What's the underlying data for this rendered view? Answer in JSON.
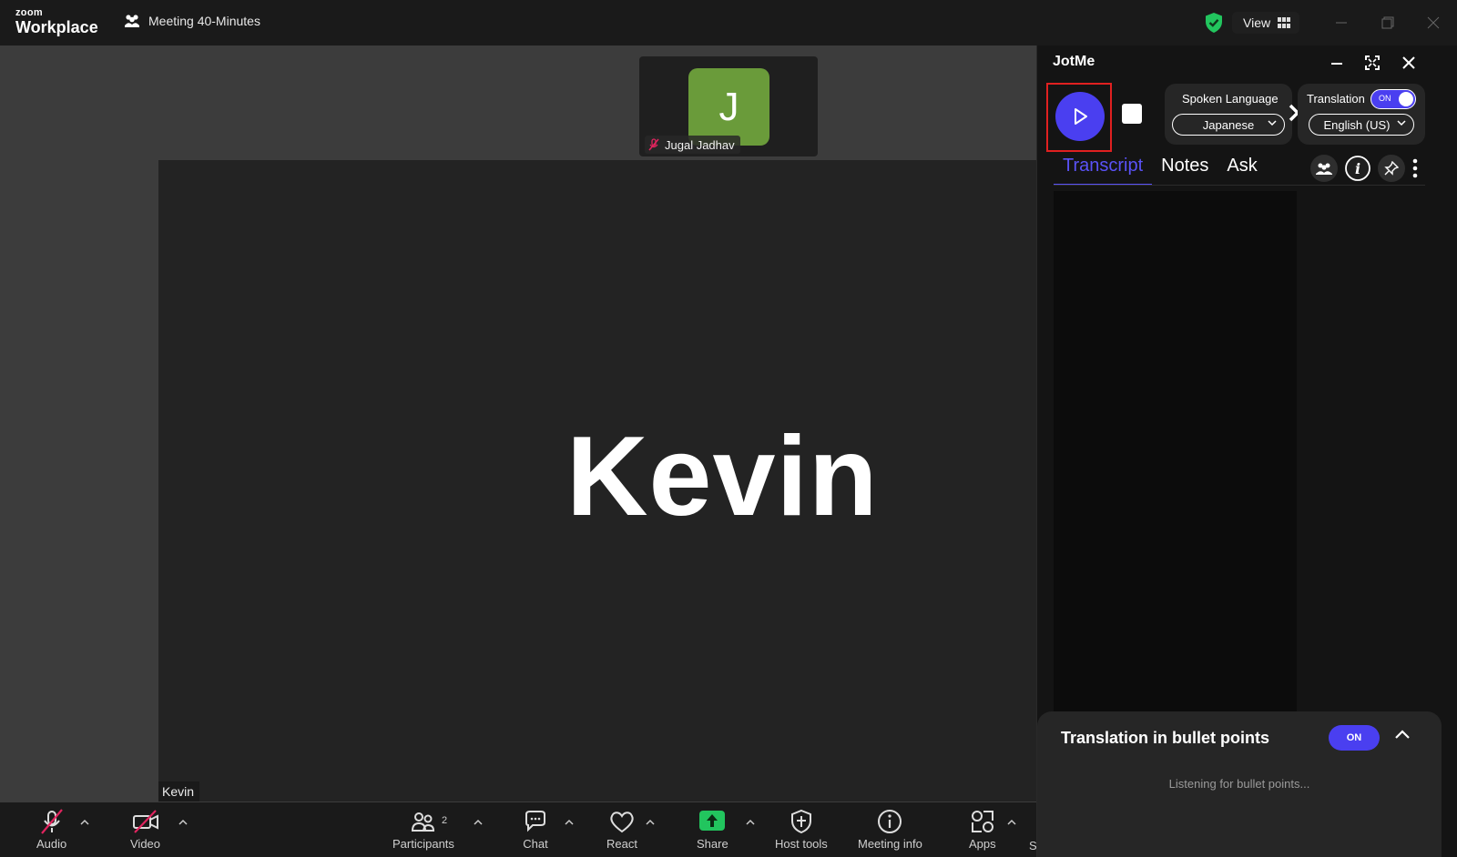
{
  "app": {
    "logo_small": "zoom",
    "logo_big": "Workplace",
    "meeting_title": "Meeting 40-Minutes",
    "view_label": "View"
  },
  "video": {
    "thumbnail_initial": "J",
    "thumbnail_name": "Jugal Jadhav",
    "main_name": "Kevin",
    "main_label": "Kevin"
  },
  "toolbar": {
    "audio": "Audio",
    "video": "Video",
    "participants": "Participants",
    "participants_count": "2",
    "chat": "Chat",
    "react": "React",
    "share": "Share",
    "host_tools": "Host tools",
    "meeting_info": "Meeting info",
    "apps": "Apps",
    "truncated": "S"
  },
  "jotme": {
    "title": "JotMe",
    "spoken_language_label": "Spoken Language",
    "spoken_language_value": "Japanese",
    "translation_label": "Translation",
    "translation_toggle": "ON",
    "target_language_value": "English (US)",
    "tabs": [
      "Transcript",
      "Notes",
      "Ask"
    ],
    "active_tab": "Transcript",
    "bullets_title": "Translation in bullet points",
    "bullets_toggle": "ON",
    "listening_text": "Listening for bullet points..."
  },
  "colors": {
    "accent": "#4a3ff0",
    "avatar_green": "#6a9b3a",
    "share_green": "#22c55e",
    "muted_red": "#e0245e",
    "highlight_box": "#e02020"
  }
}
